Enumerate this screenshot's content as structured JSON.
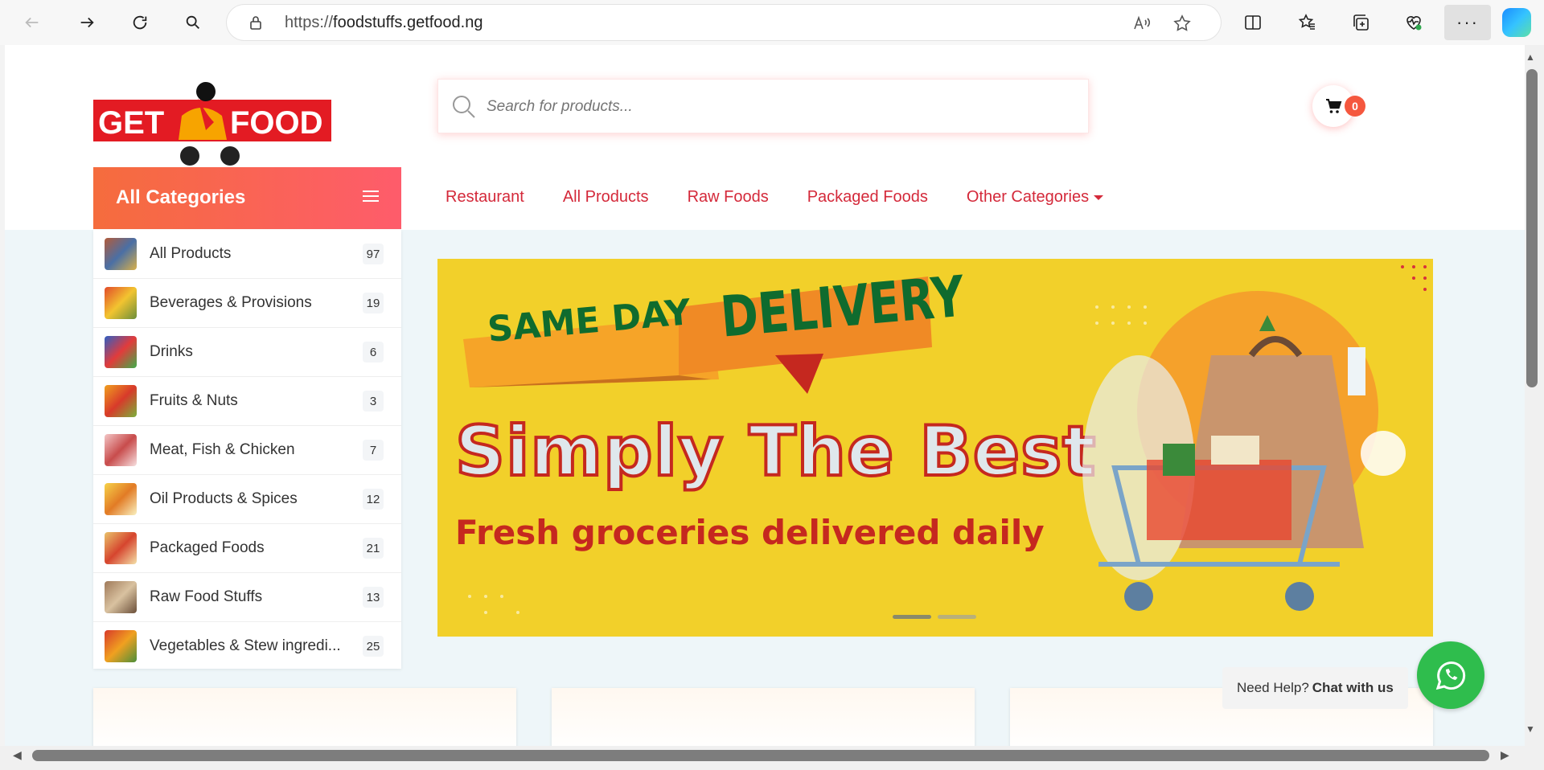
{
  "browser": {
    "url_protocol": "https://",
    "url_host": "foodstuffs.getfood.ng"
  },
  "header": {
    "logo_alt": "GET FOOD LOGISTICS",
    "search_placeholder": "Search for products...",
    "cart_count": "0"
  },
  "categories": {
    "title": "All Categories",
    "items": [
      {
        "label": "All Products",
        "count": "97"
      },
      {
        "label": "Beverages & Provisions",
        "count": "19"
      },
      {
        "label": "Drinks",
        "count": "6"
      },
      {
        "label": "Fruits & Nuts",
        "count": "3"
      },
      {
        "label": "Meat, Fish & Chicken",
        "count": "7"
      },
      {
        "label": "Oil Products & Spices",
        "count": "12"
      },
      {
        "label": "Packaged Foods",
        "count": "21"
      },
      {
        "label": "Raw Food Stuffs",
        "count": "13"
      },
      {
        "label": "Vegetables & Stew ingredi...",
        "count": "25"
      }
    ]
  },
  "nav": {
    "items": [
      "Restaurant",
      "All Products",
      "Raw Foods",
      "Packaged Foods",
      "Other Categories"
    ]
  },
  "banner": {
    "tag_left": "SAME DAY",
    "tag_right": "DELIVERY",
    "headline": "Simply The Best",
    "subline": "Fresh groceries delivered daily"
  },
  "help": {
    "prefix": "Need Help?",
    "cta": "Chat with us"
  },
  "colors": {
    "accent": "#d4293a",
    "gradient_start": "#f56c3d",
    "gradient_end": "#fe5c6b",
    "banner_yellow": "#f2d02a",
    "whatsapp": "#2fbd4d"
  }
}
